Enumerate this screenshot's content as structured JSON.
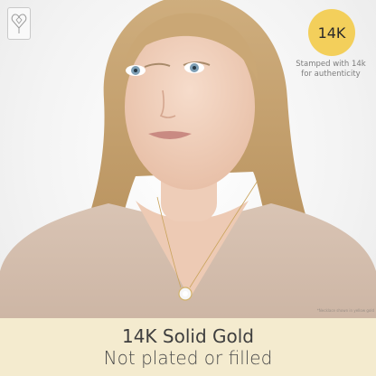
{
  "badge": {
    "label": "14K",
    "color": "#f3cf5b"
  },
  "stamp_note": {
    "line1": "Stamped with 14k",
    "line2": "for authenticity"
  },
  "fineprint": "*Necklace shown in yellow gold",
  "banner": {
    "headline": "14K Solid Gold",
    "subline": "Not plated or filled",
    "background": "#f4ebcf"
  },
  "logo": {
    "icon": "heart-diamond-icon"
  },
  "photo": {
    "subject": "woman-wearing-gold-necklace"
  }
}
